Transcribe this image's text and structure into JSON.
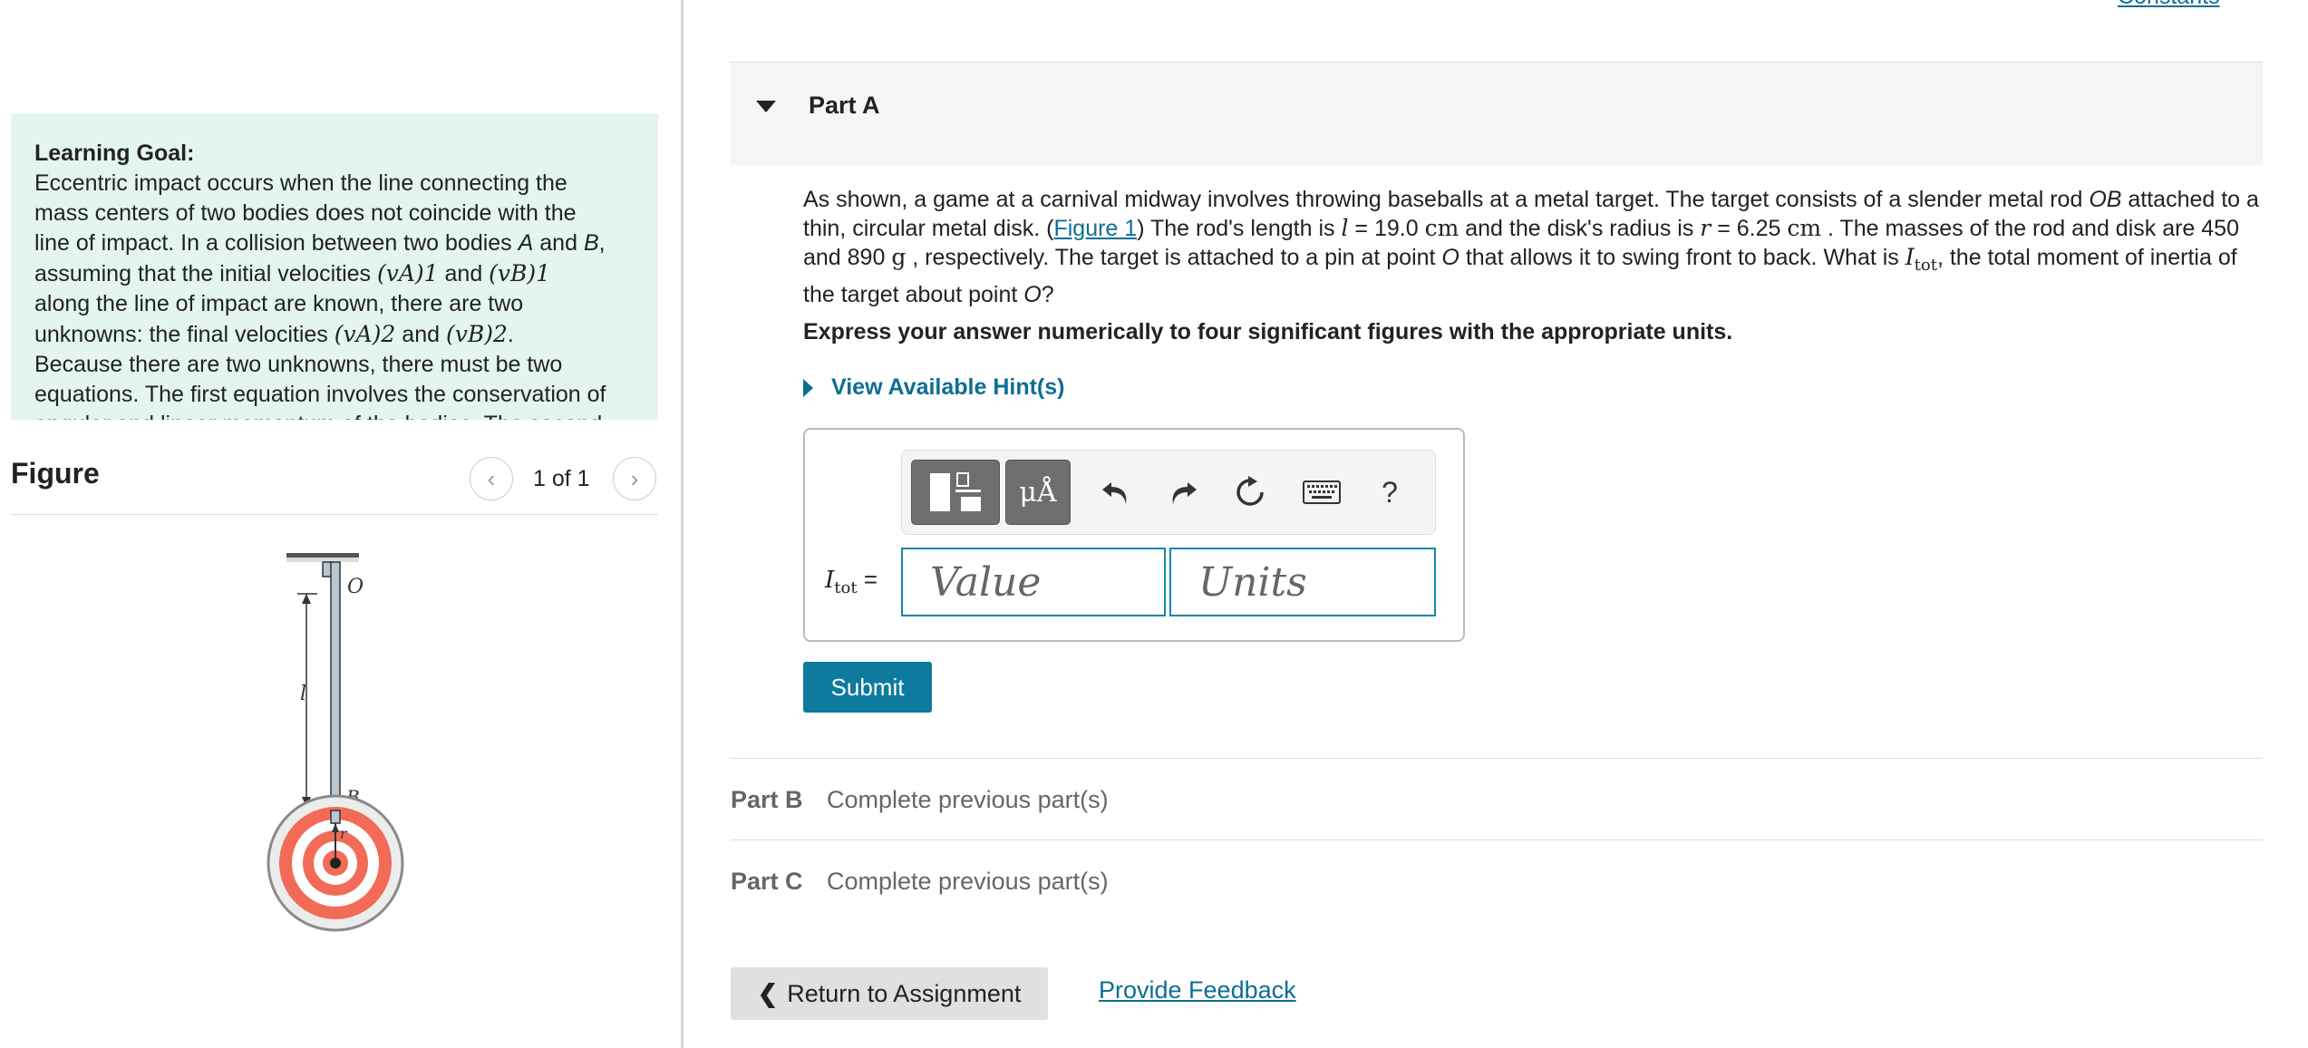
{
  "learning_goal": {
    "title": "Learning Goal:",
    "lines": [
      [
        "Eccentric impact occurs when the line connecting the"
      ],
      [
        "mass centers of two bodies does not coincide with the"
      ],
      [
        "line of impact. In a collision between two bodies ",
        "A",
        " and ",
        "B",
        ","
      ],
      [
        "assuming that the initial velocities ",
        "(vA)1",
        " and ",
        "(vB)1"
      ],
      [
        "along the line of impact are known, there are two"
      ],
      [
        "unknowns: the final velocities ",
        "(vA)2",
        " and ",
        "(vB)2",
        "."
      ],
      [
        "Because there are two unknowns, there must be two"
      ],
      [
        "equations. The first equation involves the conservation of"
      ],
      [
        "angular and linear momentum of the bodies. The second"
      ]
    ]
  },
  "figure": {
    "title": "Figure",
    "pager": "1 of 1",
    "labels": {
      "pivot": "O",
      "length": "l",
      "rod_end": "B",
      "radius": "r"
    },
    "colors": {
      "target_ring": "#f26b57",
      "disk_edge": "#8a8a8a",
      "rod": "#b9c7d0"
    }
  },
  "header": {
    "constants_link": "Constants"
  },
  "part_a": {
    "title": "Part A",
    "question": {
      "s1": "As shown, a game at a carnival midway involves throwing baseballs at a metal target. The target consists of a slender metal rod ",
      "rod_name": "OB",
      "s2": " attached to a thin, circular metal disk. (",
      "figure_link": "Figure 1",
      "s3": ") The rod's length is ",
      "l_sym": "l",
      "s4": " = 19.0 ",
      "cm1": "cm",
      "s5": " and the disk's radius is ",
      "r_sym": "r",
      "s6": " = 6.25 ",
      "cm2": "cm",
      "s7": " . The masses of the rod and disk are 450 and 890 ",
      "g_unit": "g",
      "s8": " , respectively. The target is attached to a pin at point ",
      "o_sym": "O",
      "s9": " that allows it to swing front to back. What is ",
      "itot_i": "I",
      "itot_sub": "tot",
      "s10": ", the total moment of inertia of the target about point ",
      "o_sym2": "O",
      "s11": "?"
    },
    "instruction": "Express your answer numerically to four significant figures with the appropriate units.",
    "hint_label": "View Available Hint(s)",
    "toolbar": {
      "units_symbol": "μÅ",
      "help_symbol": "?"
    },
    "answer_label_i": "I",
    "answer_label_sub": "tot",
    "answer_label_eq": " =",
    "value_placeholder": "Value",
    "units_placeholder": "Units",
    "submit_label": "Submit"
  },
  "parts": [
    {
      "name": "Part B",
      "status": "Complete previous part(s)"
    },
    {
      "name": "Part C",
      "status": "Complete previous part(s)"
    }
  ],
  "footer": {
    "return_label": "Return to Assignment",
    "feedback_link": "Provide Feedback"
  },
  "colors": {
    "accent": "#0d7a9e",
    "link": "#0d6e94",
    "goal_bg": "#e4f4f1"
  }
}
